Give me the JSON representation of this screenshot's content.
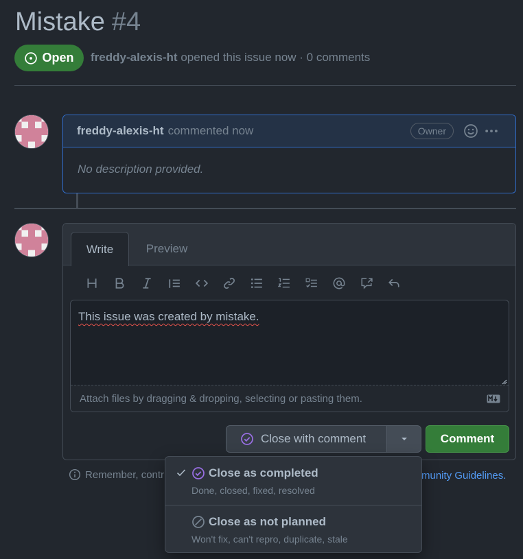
{
  "issue": {
    "title": "Mistake",
    "number": "#4",
    "state_label": "Open",
    "author": "freddy-alexis-ht",
    "meta_suffix": "opened this issue now · 0 comments"
  },
  "comment": {
    "author": "freddy-alexis-ht",
    "when": "commented now",
    "role_badge": "Owner",
    "body": "No description provided."
  },
  "composer": {
    "tabs": [
      {
        "label": "Write"
      },
      {
        "label": "Preview"
      }
    ],
    "text": "This issue was created by mistake.",
    "attach_hint": "Attach files by dragging & dropping, selecting or pasting them.",
    "close_label": "Close with comment",
    "comment_label": "Comment"
  },
  "footer": {
    "reminder": "Remember, contr",
    "guidelines_link": "munity Guidelines."
  },
  "close_menu": {
    "items": [
      {
        "title": "Close as completed",
        "subtitle": "Done, closed, fixed, resolved",
        "selected": true
      },
      {
        "title": "Close as not planned",
        "subtitle": "Won't fix, can't repro, duplicate, stale",
        "selected": false
      }
    ]
  },
  "colors": {
    "background": "#22272e",
    "open_green": "#347d39",
    "accent_blue": "#316dca",
    "completed_purple": "#986ee2",
    "link": "#539bf5"
  },
  "icons": {
    "toolbar": [
      "heading-icon",
      "bold-icon",
      "italic-icon",
      "quote-icon",
      "code-icon",
      "link-icon",
      "bullet-list-icon",
      "numbered-list-icon",
      "task-list-icon",
      "mention-icon",
      "cross-reference-icon",
      "reply-icon"
    ]
  }
}
